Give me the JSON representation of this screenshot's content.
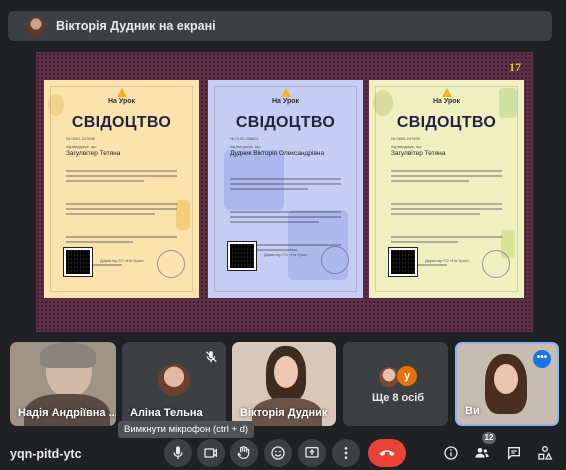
{
  "banner": {
    "text": "Вікторія Дудник на екрані"
  },
  "presentation": {
    "page_number": "17",
    "certificates": [
      {
        "brand": "На Урок",
        "title": "СВІДОЦТВО",
        "name": "Загулвітер Тетяна"
      },
      {
        "brand": "На Урок",
        "title": "СВІДОЦТВО",
        "name": "Дудник Вікторія Олександрівна"
      },
      {
        "brand": "На Урок",
        "title": "СВІДОЦТВО",
        "name": "Загулвітер Тетяна"
      }
    ]
  },
  "participants": [
    {
      "name": "Надія Андріївна ..."
    },
    {
      "name": "Аліна Тельна"
    },
    {
      "name": "Вікторія Дудник"
    },
    {
      "name": "Ще 8 осіб",
      "avatar_letter": "у"
    },
    {
      "name": "Ви",
      "more": "•••"
    }
  ],
  "tooltip": "Вимкнути мікрофон (ctrl + d)",
  "meeting_code": "yqn-pitd-ytc",
  "people_count": "12",
  "colors": {
    "end_call": "#ea4335",
    "accent": "#1a73e8",
    "bar": "#202124"
  }
}
